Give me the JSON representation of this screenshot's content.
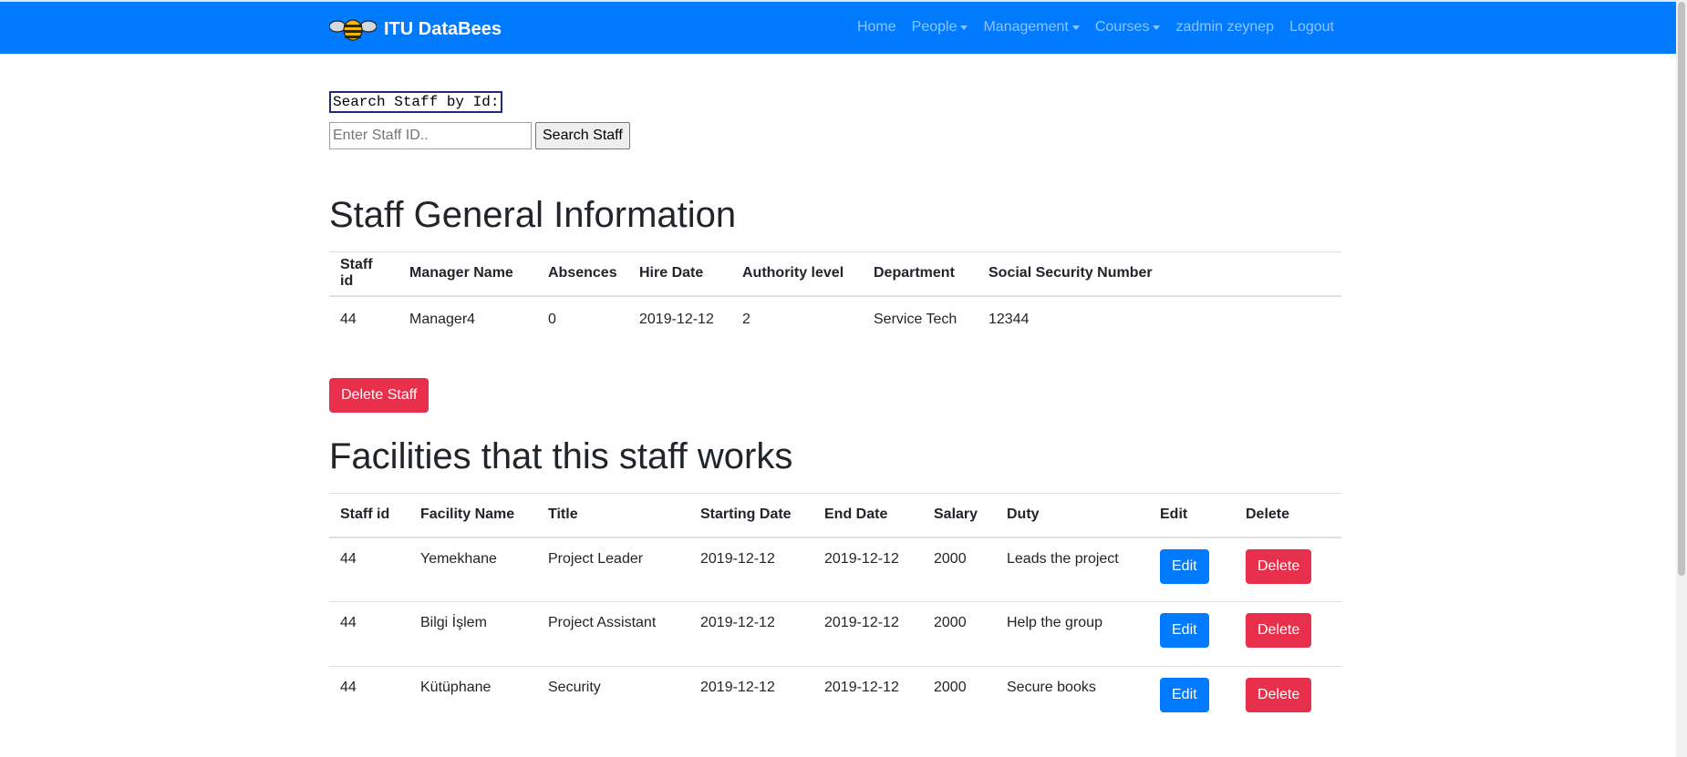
{
  "navbar": {
    "brand": "ITU DataBees",
    "links": [
      {
        "label": "Home",
        "dropdown": false
      },
      {
        "label": "People",
        "dropdown": true
      },
      {
        "label": "Management",
        "dropdown": true
      },
      {
        "label": "Courses",
        "dropdown": true
      },
      {
        "label": "zadmin zeynep",
        "dropdown": false
      },
      {
        "label": "Logout",
        "dropdown": false
      }
    ],
    "colors": {
      "background": "#007bff",
      "link": "rgba(255,255,255,0.55)"
    }
  },
  "search": {
    "label": "Search Staff by Id:",
    "placeholder": "Enter Staff ID..",
    "value": "",
    "button": "Search Staff"
  },
  "general": {
    "title": "Staff General Information",
    "headers": [
      "Staff id",
      "Manager Name",
      "Absences",
      "Hire Date",
      "Authority level",
      "Department",
      "Social Security Number"
    ],
    "rows": [
      [
        "44",
        "Manager4",
        "0",
        "2019-12-12",
        "2",
        "Service Tech",
        "12344"
      ]
    ],
    "delete_button": "Delete Staff"
  },
  "facilities": {
    "title": "Facilities that this staff works",
    "headers": [
      "Staff id",
      "Facility Name",
      "Title",
      "Starting Date",
      "End Date",
      "Salary",
      "Duty",
      "Edit",
      "Delete"
    ],
    "rows": [
      [
        "44",
        "Yemekhane",
        "Project Leader",
        "2019-12-12",
        "2019-12-12",
        "2000",
        "Leads the project"
      ],
      [
        "44",
        "Bilgi İşlem",
        "Project Assistant",
        "2019-12-12",
        "2019-12-12",
        "2000",
        "Help the group"
      ],
      [
        "44",
        "Kütüphane",
        "Security",
        "2019-12-12",
        "2019-12-12",
        "2000",
        "Secure books"
      ]
    ],
    "edit_label": "Edit",
    "delete_label": "Delete"
  },
  "colors": {
    "danger": "#e8304d",
    "primary": "#007bff"
  }
}
